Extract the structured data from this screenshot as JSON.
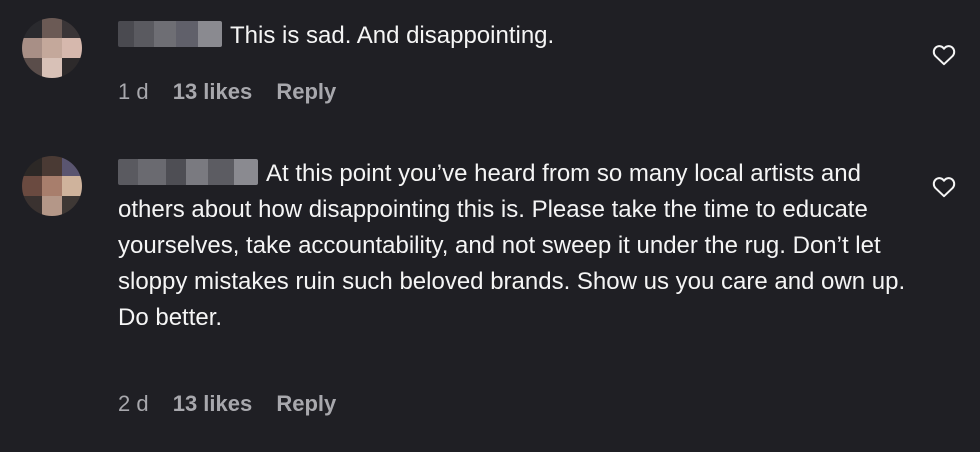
{
  "comments": [
    {
      "text": "This is sad. And disappointing.",
      "time": "1 d",
      "likes": "13 likes",
      "reply_label": "Reply"
    },
    {
      "text": "At this point you’ve heard from so many local artists and others about how disappointing this is. Please take the time to educate yourselves, take accountability, and not sweep it under the rug. Don’t let sloppy mistakes ruin such beloved brands. Show us you care and own up. Do better.",
      "time": "2 d",
      "likes": "13 likes",
      "reply_label": "Reply"
    }
  ],
  "icons": {
    "like": "heart-icon"
  },
  "colors": {
    "background": "#1f1f24",
    "text": "#f5f5f5",
    "meta": "#a8a8ad"
  }
}
